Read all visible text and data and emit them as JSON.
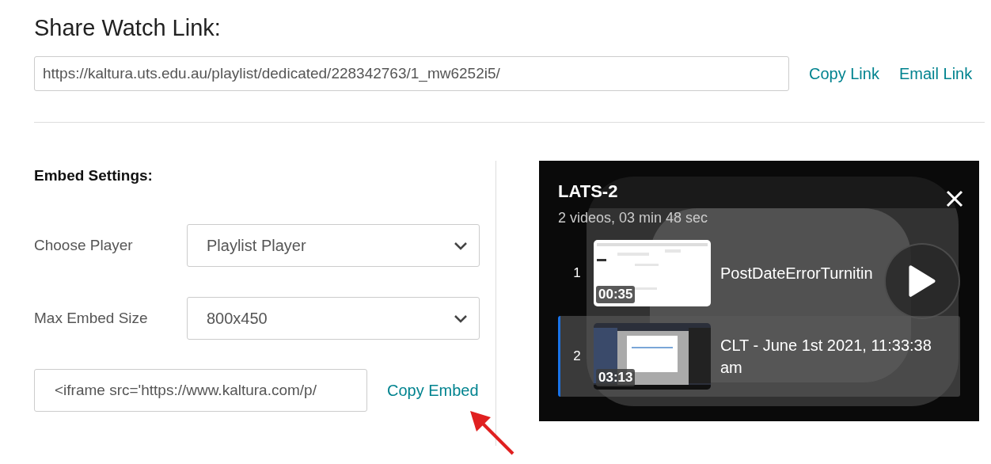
{
  "share": {
    "title": "Share Watch Link:",
    "url": "https://kaltura.uts.edu.au/playlist/dedicated/228342763/1_mw6252i5/",
    "links": [
      "Copy Link",
      "Email Link"
    ]
  },
  "embed": {
    "title": "Embed Settings:",
    "settings": [
      {
        "label": "Choose Player",
        "value": "Playlist Player"
      },
      {
        "label": "Max Embed Size",
        "value": "800x450"
      }
    ],
    "code": "<iframe src='https://www.kaltura.com/p/",
    "copy": "Copy Embed"
  },
  "player": {
    "title": "LATS-2",
    "subtitle": "2 videos, 03 min 48 sec",
    "items": [
      {
        "number": "1",
        "duration": "00:35",
        "title": "PostDateErrorTurnitin",
        "selected": false,
        "kind": "picture"
      },
      {
        "number": "2",
        "duration": "03:13",
        "title": "CLT - June 1st 2021, 11:33:38 am",
        "selected": true,
        "kind": "picture"
      }
    ]
  }
}
